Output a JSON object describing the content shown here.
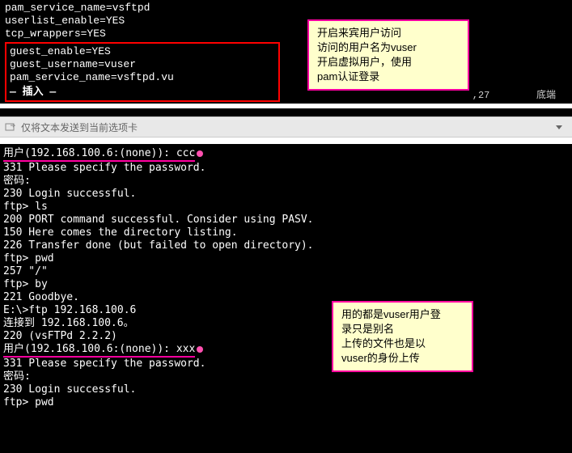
{
  "config": {
    "line1": "pam_service_name=vsftpd",
    "line2": "userlist_enable=YES",
    "line3": "tcp_wrappers=YES",
    "boxed": {
      "l1": "guest_enable=YES",
      "l2": "guest_username=vuser",
      "l3": "pam_service_name=vsftpd.vu"
    },
    "insert": "— 插入 —"
  },
  "status": {
    "pos": "    ,27",
    "mode": "底端"
  },
  "note1": {
    "l1": "开启来宾用户访问",
    "l2": "访问的用户名为vuser",
    "l3": "开启虚拟用户，使用",
    "l4": "pam认证登录"
  },
  "note2": {
    "l1": "用的都是vuser用户登",
    "l2": "录只是别名",
    "l3": "上传的文件也是以",
    "l4": "vuser的身份上传"
  },
  "tabbar": {
    "text": "仅将文本发送到当前选项卡"
  },
  "terminal": {
    "l1": "用户(192.168.100.6:(none)): ccc",
    "l2": "331 Please specify the password.",
    "l3": "密码:",
    "l4": "230 Login successful.",
    "l5": "ftp> ls",
    "l6": "200 PORT command successful. Consider using PASV.",
    "l7": "150 Here comes the directory listing.",
    "l8": "226 Transfer done (but failed to open directory).",
    "l9": "ftp> pwd",
    "l10": "257 \"/\"",
    "l11": "ftp> by",
    "l12": "221 Goodbye.",
    "l13": "",
    "l14": "E:\\>ftp 192.168.100.6",
    "l15": "连接到 192.168.100.6。",
    "l16": "220 (vsFTPd 2.2.2)",
    "l17": "用户(192.168.100.6:(none)): xxx",
    "l18": "331 Please specify the password.",
    "l19": "密码:",
    "l20": "230 Login successful.",
    "l21": "ftp> pwd"
  }
}
